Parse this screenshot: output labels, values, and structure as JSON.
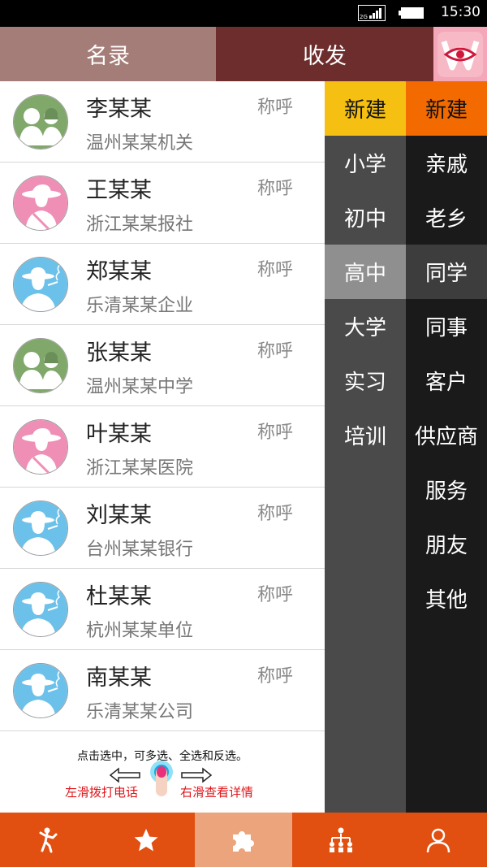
{
  "status": {
    "time": "15:30",
    "network": "2G"
  },
  "tabs": {
    "roster": "名录",
    "send": "收发",
    "logo_icon": "w-eye-logo-icon"
  },
  "contacts": [
    {
      "name": "李某某",
      "org": "温州某某机关",
      "title": "称呼",
      "avatar": "group"
    },
    {
      "name": "王某某",
      "org": "浙江某某报社",
      "title": "称呼",
      "avatar": "lady"
    },
    {
      "name": "郑某某",
      "org": "乐清某某企业",
      "title": "称呼",
      "avatar": "man"
    },
    {
      "name": "张某某",
      "org": "温州某某中学",
      "title": "称呼",
      "avatar": "group"
    },
    {
      "name": "叶某某",
      "org": "浙江某某医院",
      "title": "称呼",
      "avatar": "lady"
    },
    {
      "name": "刘某某",
      "org": "台州某某银行",
      "title": "称呼",
      "avatar": "man"
    },
    {
      "name": "杜某某",
      "org": "杭州某某单位",
      "title": "称呼",
      "avatar": "man"
    },
    {
      "name": "南某某",
      "org": "乐清某某公司",
      "title": "称呼",
      "avatar": "man"
    }
  ],
  "hint": {
    "main": "点击选中，可多选、全选和反选。",
    "left": "左滑拨打电话",
    "right": "右滑查看详情"
  },
  "groups": {
    "new_label": "新建",
    "col1": [
      "小学",
      "初中",
      "高中",
      "大学",
      "实习",
      "培训"
    ],
    "col2": [
      "亲戚",
      "老乡",
      "同学",
      "同事",
      "客户",
      "供应商",
      "服务",
      "朋友",
      "其他"
    ],
    "selected_col1": "高中",
    "selected_col2": "同学"
  },
  "bottom_nav": [
    {
      "icon": "dancer-icon",
      "active": false
    },
    {
      "icon": "star-icon",
      "active": false
    },
    {
      "icon": "puzzle-icon",
      "active": true
    },
    {
      "icon": "org-chart-icon",
      "active": false
    },
    {
      "icon": "person-icon",
      "active": false
    }
  ],
  "colors": {
    "tab_roster": "#a57d78",
    "tab_send": "#6d2d2c",
    "new_yellow": "#f5c011",
    "new_orange": "#f26a00",
    "bottom_bar": "#e14f11",
    "bottom_active": "#eba47c"
  }
}
